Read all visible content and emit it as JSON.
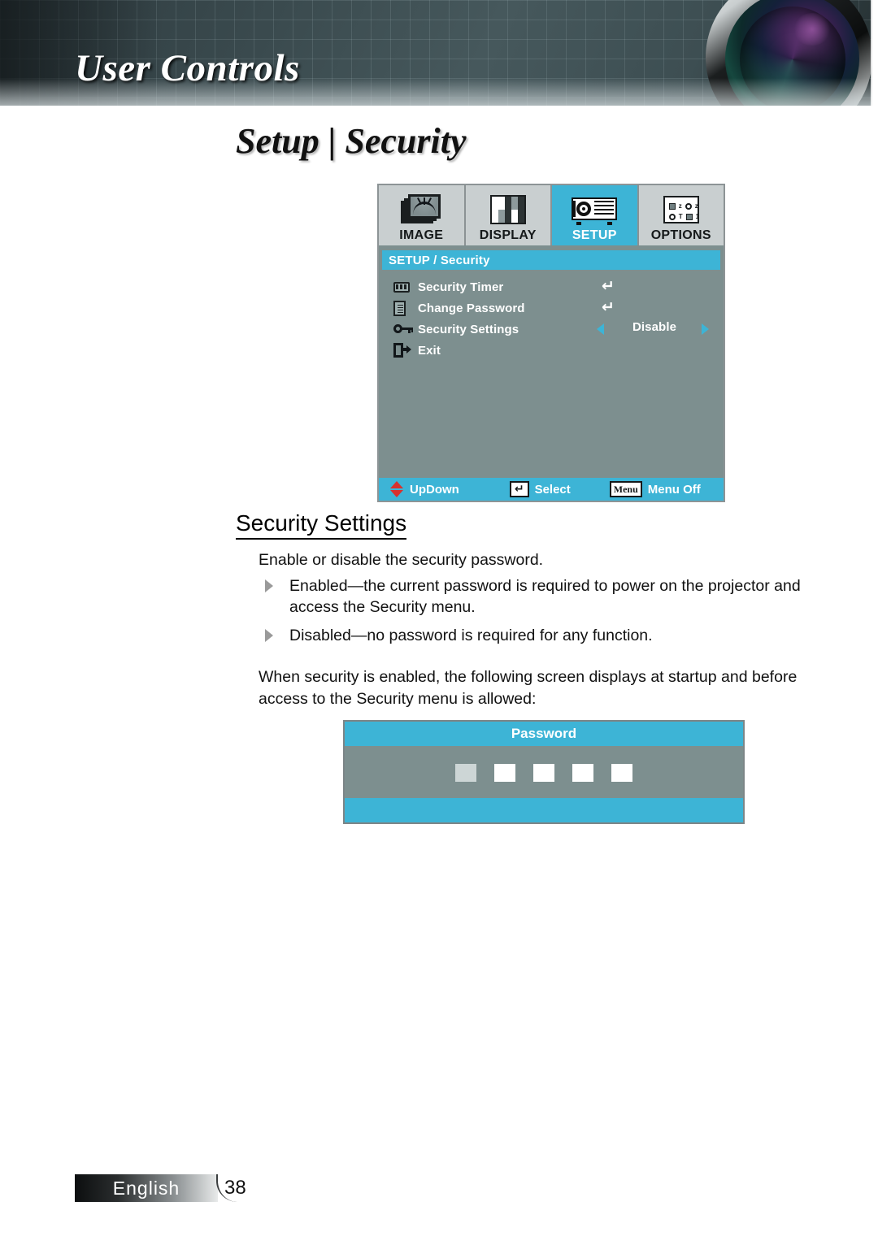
{
  "banner": {
    "title": "User Controls",
    "lens_icon": "camera-lens-graphic"
  },
  "page_title": "Setup | Security",
  "osd": {
    "tabs": [
      {
        "label": "IMAGE",
        "icon": "image-stack-icon",
        "active": false
      },
      {
        "label": "DISPLAY",
        "icon": "display-bars-icon",
        "active": false
      },
      {
        "label": "SETUP",
        "icon": "projector-icon",
        "active": true
      },
      {
        "label": "OPTIONS",
        "icon": "options-grid-icon",
        "active": false
      }
    ],
    "breadcrumb": "SETUP / Security",
    "rows": [
      {
        "icon": "security-timer-icon",
        "label": "Security Timer",
        "control": "enter",
        "value": ""
      },
      {
        "icon": "change-password-icon",
        "label": "Change Password",
        "control": "enter",
        "value": ""
      },
      {
        "icon": "key-icon",
        "label": "Security Settings",
        "control": "spinner",
        "value": "Disable"
      },
      {
        "icon": "exit-door-icon",
        "label": "Exit",
        "control": "none",
        "value": ""
      }
    ],
    "footer": [
      {
        "icon": "up-down-arrows-icon",
        "label": "UpDown",
        "key": ""
      },
      {
        "icon": "enter-key-icon",
        "label": "Select",
        "key": "↵"
      },
      {
        "icon": "menu-key-icon",
        "label": "Menu Off",
        "key": "Menu"
      }
    ],
    "colors": {
      "accent": "#3db4d6",
      "menu_bg": "#7d8f8f",
      "tab_bg": "#c9cfd0"
    }
  },
  "section": {
    "heading": "Security Settings",
    "intro": "Enable or disable the security password.",
    "bullets": [
      "Enabled—the current password is required to power on the projector and access the Security menu.",
      "Disabled—no password is required for any function."
    ],
    "closing": "When security is enabled, the following screen displays at startup and before access to the Security menu is allowed:"
  },
  "password_dialog": {
    "title": "Password",
    "boxes": [
      "",
      "",
      "",
      "",
      ""
    ],
    "active_box_index": 0
  },
  "footer": {
    "language": "English",
    "page_number": "38"
  }
}
